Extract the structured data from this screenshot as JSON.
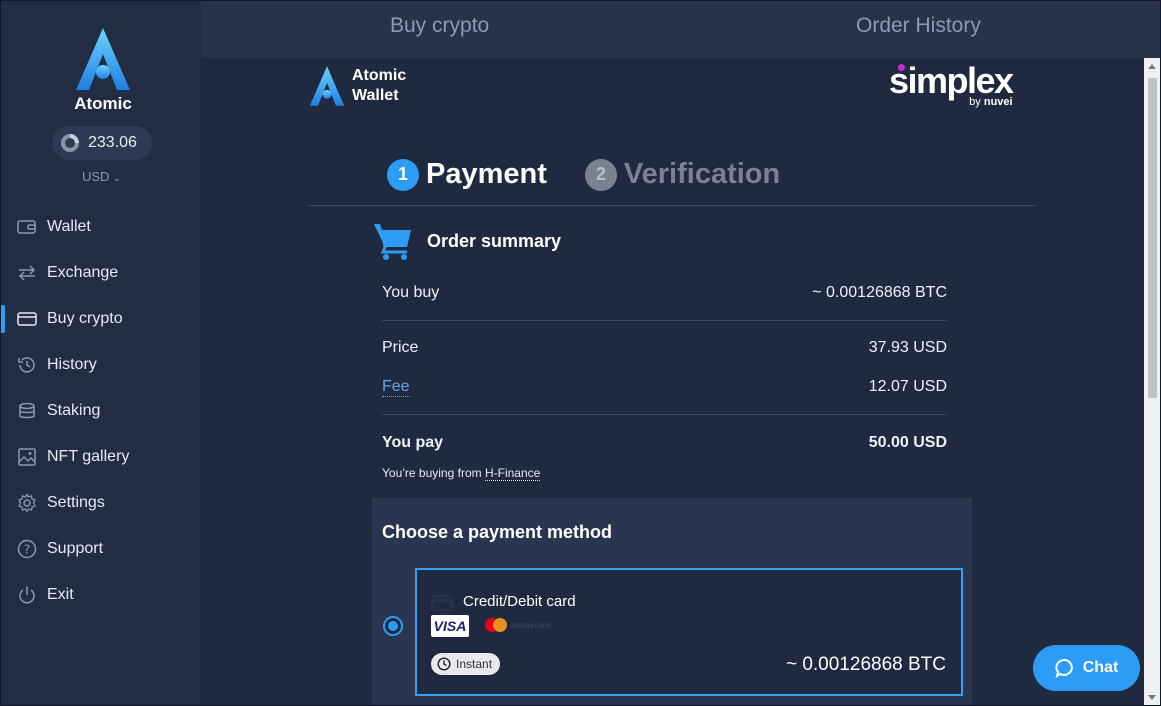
{
  "sidebar": {
    "brand": "Atomic",
    "balance": "233.06",
    "currency": "USD",
    "items": [
      {
        "label": "Wallet",
        "icon": "wallet-icon"
      },
      {
        "label": "Exchange",
        "icon": "exchange-icon"
      },
      {
        "label": "Buy crypto",
        "icon": "card-icon",
        "active": true
      },
      {
        "label": "History",
        "icon": "history-icon"
      },
      {
        "label": "Staking",
        "icon": "staking-icon"
      },
      {
        "label": "NFT gallery",
        "icon": "image-icon"
      },
      {
        "label": "Settings",
        "icon": "gear-icon"
      },
      {
        "label": "Support",
        "icon": "help-icon"
      },
      {
        "label": "Exit",
        "icon": "power-icon"
      }
    ]
  },
  "tabs": {
    "buy": "Buy crypto",
    "history": "Order History"
  },
  "partner": {
    "wallet_line1": "Atomic",
    "wallet_line2": "Wallet",
    "simplex_name": "simplex",
    "simplex_by": "by",
    "simplex_nuvei": "nuvei"
  },
  "steps": [
    {
      "num": "1",
      "label": "Payment"
    },
    {
      "num": "2",
      "label": "Verification"
    }
  ],
  "order": {
    "title": "Order summary",
    "you_buy_label": "You buy",
    "you_buy_value": "~ 0.00126868 BTC",
    "price_label": "Price",
    "price_value": "37.93 USD",
    "fee_label": "Fee",
    "fee_value": "12.07 USD",
    "you_pay_label": "You pay",
    "you_pay_value": "50.00 USD",
    "buying_from_prefix": "You’re buying from",
    "buying_from_name": "H-Finance"
  },
  "payment": {
    "title": "Choose a payment method",
    "option_label": "Credit/Debit card",
    "visa": "VISA",
    "mastercard": "mastercard",
    "instant": "Instant",
    "amount": "~ 0.00126868 BTC"
  },
  "chat": {
    "label": "Chat"
  },
  "colors": {
    "accent": "#2d9cf6",
    "sidebar": "#222d44",
    "content": "#1f2a40"
  }
}
